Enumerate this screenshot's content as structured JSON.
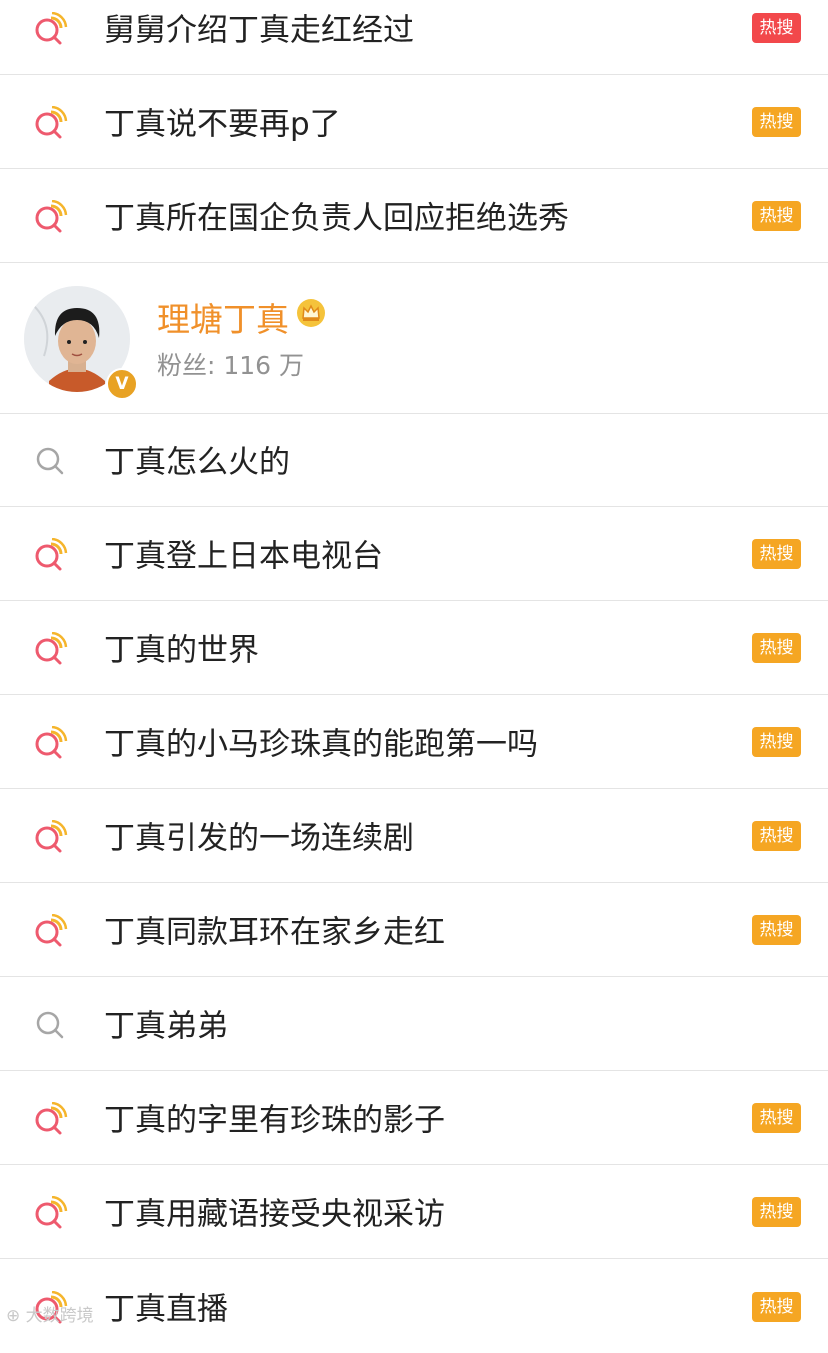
{
  "results": [
    {
      "text": "舅舅介绍丁真走红经过",
      "badge": "热搜",
      "icon": "hot-search-icon",
      "badge_color": "#f2484b"
    },
    {
      "text": "丁真说不要再p了",
      "badge": "热搜",
      "icon": "hot-search-icon",
      "badge_color": "#f5a623"
    },
    {
      "text": "丁真所在国企负责人回应拒绝选秀",
      "badge": "热搜",
      "icon": "hot-search-icon",
      "badge_color": "#f5a623"
    },
    {
      "text": "丁真怎么火的",
      "badge": "",
      "icon": "search-icon"
    },
    {
      "text": "丁真登上日本电视台",
      "badge": "热搜",
      "icon": "hot-search-icon",
      "badge_color": "#f5a623"
    },
    {
      "text": "丁真的世界",
      "badge": "热搜",
      "icon": "hot-search-icon",
      "badge_color": "#f5a623"
    },
    {
      "text": "丁真的小马珍珠真的能跑第一吗",
      "badge": "热搜",
      "icon": "hot-search-icon",
      "badge_color": "#f5a623"
    },
    {
      "text": "丁真引发的一场连续剧",
      "badge": "热搜",
      "icon": "hot-search-icon",
      "badge_color": "#f5a623"
    },
    {
      "text": "丁真同款耳环在家乡走红",
      "badge": "热搜",
      "icon": "hot-search-icon",
      "badge_color": "#f5a623"
    },
    {
      "text": "丁真弟弟",
      "badge": "",
      "icon": "search-icon"
    },
    {
      "text": "丁真的字里有珍珠的影子",
      "badge": "热搜",
      "icon": "hot-search-icon",
      "badge_color": "#f5a623"
    },
    {
      "text": "丁真用藏语接受央视采访",
      "badge": "热搜",
      "icon": "hot-search-icon",
      "badge_color": "#f5a623"
    },
    {
      "text": "丁真直播",
      "badge": "热搜",
      "icon": "hot-search-icon",
      "badge_color": "#f5a623"
    }
  ],
  "user": {
    "name": "理塘丁真",
    "fans_label": "粉丝: 116 万",
    "verified_mark": "V",
    "name_color": "#f0902a"
  },
  "watermark": "大数跨境"
}
